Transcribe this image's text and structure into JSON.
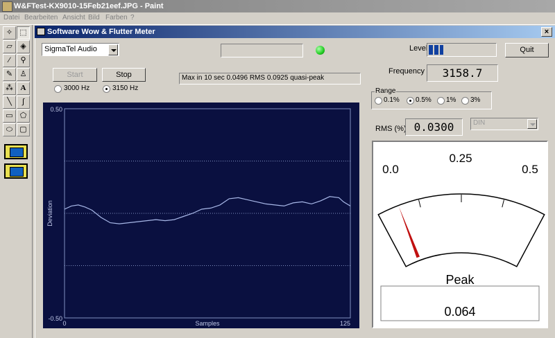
{
  "paint_window": {
    "title": "W&FTest-KX9010-15Feb21eef.JPG - Paint",
    "menu": [
      "Datei",
      "Bearbeiten",
      "Ansicht",
      "Bild",
      "Farben",
      "?"
    ]
  },
  "app": {
    "title": "Software Wow & Flutter Meter",
    "device_select": "SigmaTel Audio",
    "start_label": "Start",
    "stop_label": "Stop",
    "freq_options": [
      "3000 Hz",
      "3150 Hz"
    ],
    "freq_selected": "3150 Hz",
    "status_text": "Max in 10 sec 0.0496 RMS 0.0925 quasi-peak",
    "level_label": "Level",
    "level_fraction": 0.22,
    "quit_label": "Quit",
    "frequency_label": "Frequency",
    "frequency_value": "3158.7",
    "range_label": "Range",
    "range_options": [
      "0.1%",
      "0.5%",
      "1%",
      "3%"
    ],
    "range_selected": "0.5%",
    "rms_label": "RMS (%)",
    "rms_value": "0.0300",
    "weighting_select": "DIN",
    "indicator_color": "#22cc22"
  },
  "graph": {
    "y_top_label": "0.50",
    "y_bottom_label": "-0.50",
    "x_left_label": "0",
    "x_right_label": "125",
    "xlabel": "Samples",
    "ylabel": "Deviation"
  },
  "chart_data": {
    "type": "line",
    "xlabel": "Samples",
    "ylabel": "Deviation",
    "xlim": [
      0,
      125
    ],
    "ylim": [
      -0.5,
      0.5
    ],
    "grid": "dotted lines at 0.25, 0, -0.25",
    "series": [
      {
        "color": "#a8b8e8",
        "x": [
          0,
          3,
          6,
          9,
          12,
          16,
          20,
          24,
          28,
          32,
          36,
          40,
          44,
          48,
          52,
          56,
          60,
          64,
          68,
          72,
          76,
          80,
          84,
          88,
          92,
          96,
          100,
          104,
          108,
          112,
          116,
          120,
          122,
          125
        ],
        "y": [
          0.02,
          0.035,
          0.04,
          0.03,
          0.015,
          -0.02,
          -0.045,
          -0.05,
          -0.045,
          -0.04,
          -0.035,
          -0.03,
          -0.035,
          -0.03,
          -0.015,
          0.0,
          0.02,
          0.025,
          0.04,
          0.07,
          0.075,
          0.065,
          0.055,
          0.045,
          0.04,
          0.035,
          0.05,
          0.055,
          0.045,
          0.06,
          0.08,
          0.075,
          0.055,
          0.035
        ]
      }
    ]
  },
  "meter": {
    "scale_labels": [
      "0.0",
      "0.25",
      "0.5"
    ],
    "scale_max": 0.5,
    "reading": 0.064,
    "needle_color": "#c01010",
    "peak_label": "Peak",
    "peak_value": "0.064"
  }
}
